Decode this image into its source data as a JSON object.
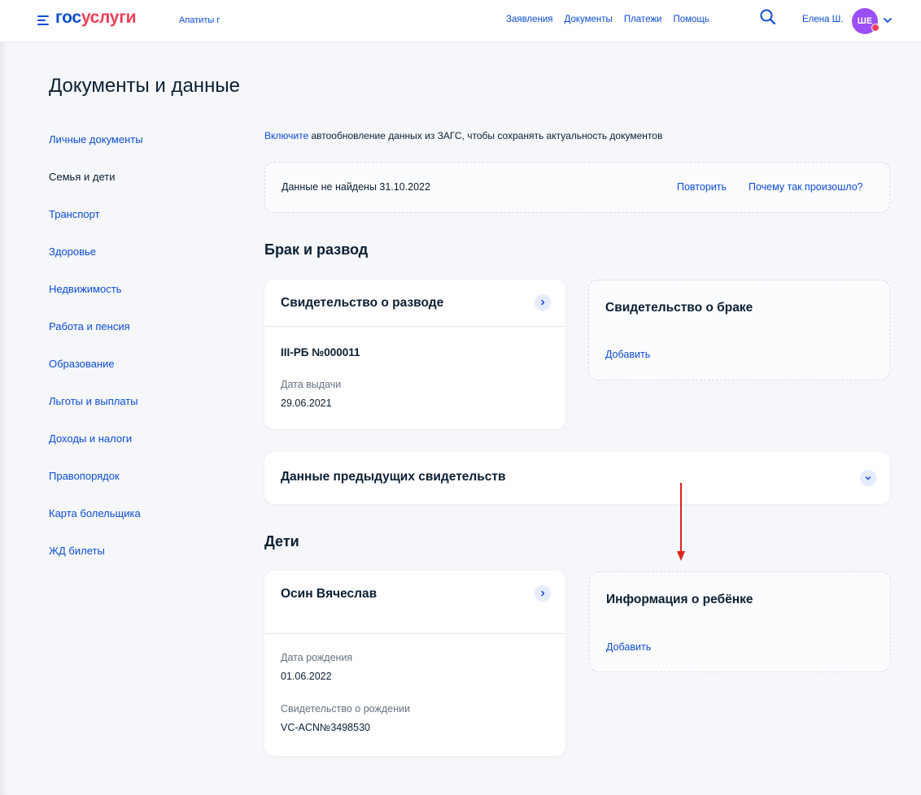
{
  "header": {
    "logo_part1": "гос",
    "logo_part2": "услуги",
    "city": "Апатиты г",
    "nav": [
      "Заявления",
      "Документы",
      "Платежи",
      "Помощь"
    ],
    "user_name": "Елена Ш.",
    "avatar_initials": "ШЕ",
    "icons": [
      "menu-icon",
      "search-icon",
      "chevron-down-icon"
    ]
  },
  "page": {
    "title": "Документы и данные"
  },
  "sidebar": {
    "items": [
      {
        "label": "Личные документы",
        "active": false
      },
      {
        "label": "Семья и дети",
        "active": true
      },
      {
        "label": "Транспорт",
        "active": false
      },
      {
        "label": "Здоровье",
        "active": false
      },
      {
        "label": "Недвижимость",
        "active": false
      },
      {
        "label": "Работа и пенсия",
        "active": false
      },
      {
        "label": "Образование",
        "active": false
      },
      {
        "label": "Льготы и выплаты",
        "active": false
      },
      {
        "label": "Доходы и налоги",
        "active": false
      },
      {
        "label": "Правопорядок",
        "active": false
      },
      {
        "label": "Карта болельщика",
        "active": false
      },
      {
        "label": "ЖД билеты",
        "active": false
      }
    ]
  },
  "notice": {
    "link": "Включите",
    "text": " автообновление данных из ЗАГС, чтобы сохранять актуальность документов"
  },
  "status": {
    "text": "Данные не найдены 31.10.2022",
    "retry": "Повторить",
    "why": "Почему так произошло?"
  },
  "marriage": {
    "section_title": "Брак и развод",
    "divorce_card": {
      "title": "Свидетельство о разводе",
      "number": "III-РБ №000011",
      "issue_label": "Дата выдачи",
      "issue_date": "29.06.2021"
    },
    "marriage_card": {
      "title": "Свидетельство о браке",
      "add": "Добавить"
    },
    "previous": {
      "title": "Данные предыдущих свидетельств"
    }
  },
  "children": {
    "section_title": "Дети",
    "child_card": {
      "name": "Осин Вячеслав",
      "birth_label": "Дата рождения",
      "birth_date": "01.06.2022",
      "cert_label": "Свидетельство о рождении",
      "cert_number": "VC-ACN№3498530"
    },
    "info_card": {
      "title": "Информация о ребёнке",
      "add": "Добавить"
    }
  },
  "colors": {
    "brand_blue": "#0d4cd3",
    "brand_red": "#ee3f58",
    "avatar": "#9b4ef5",
    "annotation_arrow": "#e0231b"
  }
}
